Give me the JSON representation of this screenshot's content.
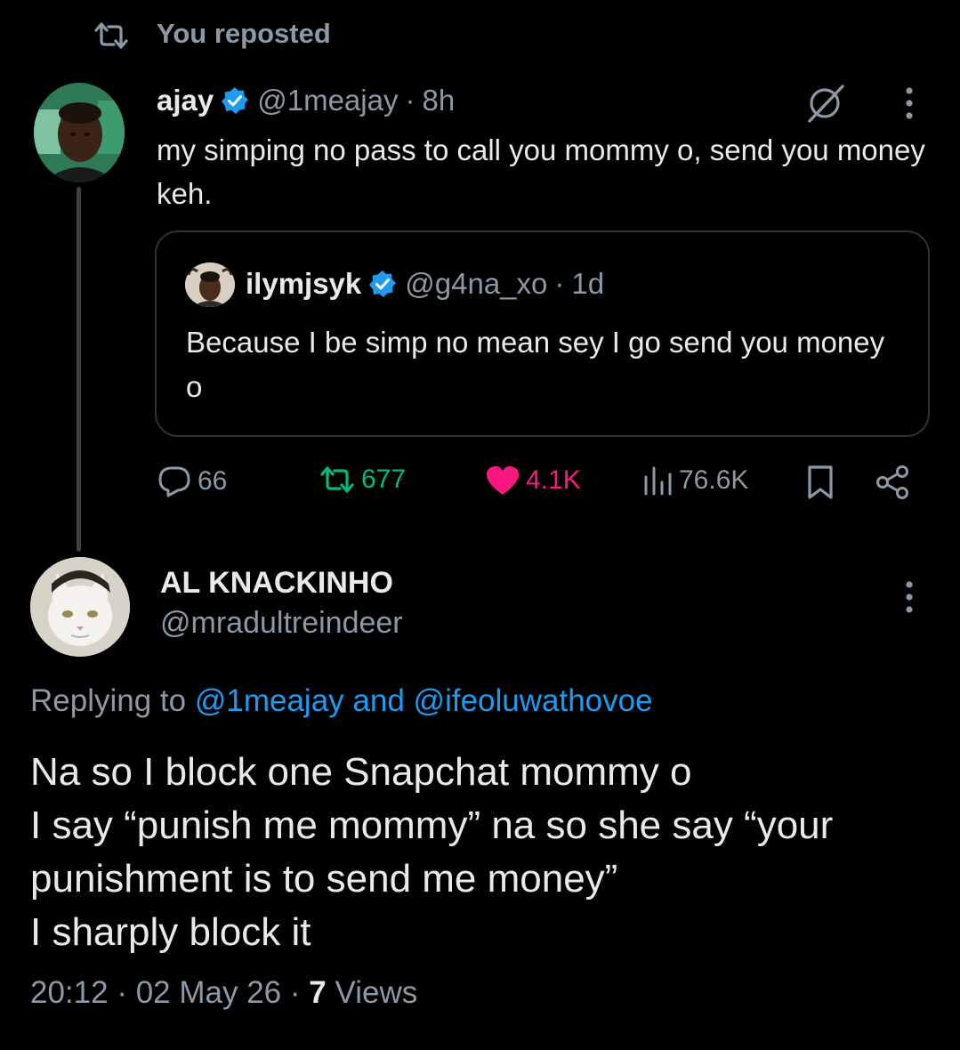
{
  "repost_banner": {
    "label": "You reposted",
    "icon": "repost-icon"
  },
  "original_tweet": {
    "display_name": "ajay",
    "handle": "@1meajay",
    "separator": "·",
    "time": "8h",
    "text": "my simping no pass to call you mommy o, send you money keh.",
    "quoted": {
      "display_name": "ilymjsyk",
      "handle": "@g4na_xo",
      "separator": "·",
      "time": "1d",
      "text": "Because I be simp no mean sey I go send you money o"
    },
    "actions": {
      "replies": "66",
      "reposts": "677",
      "likes": "4.1K",
      "views": "76.6K"
    }
  },
  "reply": {
    "display_name": "AL KNACKINHO",
    "handle": "@mradultreindeer",
    "replying_prefix": "Replying to",
    "mention_1": "@1meajay",
    "replying_joiner": "and",
    "mention_2": "@ifeoluwathovoe",
    "text_lines": [
      "Na so I block one Snapchat mommy o",
      "I say “punish me mommy” na so she say “your",
      "punishment is to send me money”",
      "I sharply block it"
    ],
    "time": "20:12",
    "date": "02 May 26",
    "separator": "·",
    "views_count": "7",
    "views_label": "Views"
  },
  "colors": {
    "background": "#000000",
    "text": "#e7e9ea",
    "muted": "#8b98a5",
    "accent_blue": "#1d9bf0",
    "repost_green": "#00ba7c",
    "like_pink": "#f91880",
    "border": "#2f3336"
  }
}
